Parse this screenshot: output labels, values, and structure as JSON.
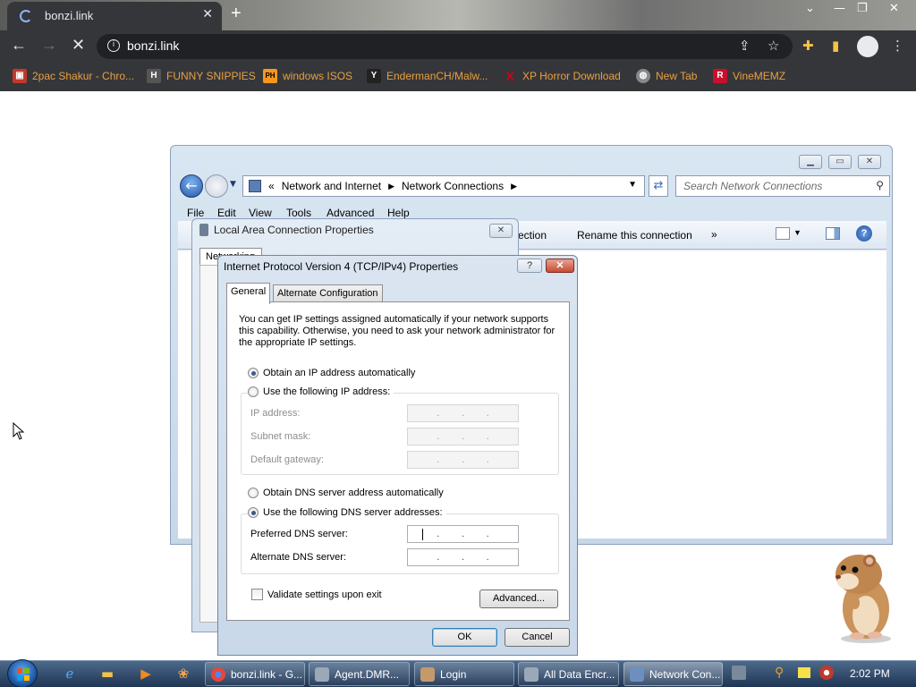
{
  "browser": {
    "tab_title": "bonzi.link",
    "url": "bonzi.link",
    "bookmarks": [
      {
        "label": "2pac Shakur - Chro...",
        "icon": "tupac-icon",
        "color": "#c0392b"
      },
      {
        "label": "FUNNY SNIPPIES",
        "icon": "h-icon",
        "color": "#555555"
      },
      {
        "label": "windows ISOS",
        "icon": "ph-icon",
        "color": "#f7971d"
      },
      {
        "label": "EndermanCH/Malw...",
        "icon": "github-icon",
        "color": "#222222"
      },
      {
        "label": "XP Horror Download",
        "icon": "x-icon",
        "color": "#d0021b"
      },
      {
        "label": "New Tab",
        "icon": "globe-icon",
        "color": "#888888"
      },
      {
        "label": "VineMEMZ",
        "icon": "r-icon",
        "color": "#c8102e"
      }
    ],
    "bookmark_glyphs": [
      "▣",
      "H",
      "PH",
      "Y",
      "X",
      "◍",
      "R"
    ]
  },
  "explorer": {
    "breadcrumb_prefix": "«",
    "breadcrumb": [
      "Network and Internet",
      "Network Connections"
    ],
    "search_placeholder": "Search Network Connections",
    "menus": [
      "File",
      "Edit",
      "View",
      "Tools",
      "Advanced",
      "Help"
    ],
    "commands": [
      "ection",
      "Rename this connection",
      "»"
    ]
  },
  "lan_properties": {
    "title": "Local Area Connection Properties",
    "tab_fragment": "Networking"
  },
  "ipv4": {
    "title": "Internet Protocol Version 4 (TCP/IPv4) Properties",
    "help_label": "?",
    "tabs": [
      "General",
      "Alternate Configuration"
    ],
    "intro": "You can get IP settings assigned automatically if your network supports this capability. Otherwise, you need to ask your network administrator for the appropriate IP settings.",
    "obtain_ip_auto": "Obtain an IP address automatically",
    "use_following_ip": "Use the following IP address:",
    "ip_address_label": "IP address:",
    "subnet_mask_label": "Subnet mask:",
    "default_gateway_label": "Default gateway:",
    "obtain_dns_auto": "Obtain DNS server address automatically",
    "use_following_dns": "Use the following DNS server addresses:",
    "preferred_dns_label": "Preferred DNS server:",
    "alternate_dns_label": "Alternate DNS server:",
    "validate_label": "Validate settings upon exit",
    "advanced_label": "Advanced...",
    "ok_label": "OK",
    "cancel_label": "Cancel",
    "ip_mode": "automatic",
    "dns_mode": "manual"
  },
  "taskbar": {
    "items": [
      {
        "label": "bonzi.link - G...",
        "icon": "chrome-icon",
        "color": "#e8453c"
      },
      {
        "label": "Agent.DMR...",
        "icon": "window-icon",
        "color": "#9aa8b8"
      },
      {
        "label": "Login",
        "icon": "user-icon",
        "color": "#c49a6c"
      },
      {
        "label": "All Data Encr...",
        "icon": "window-icon",
        "color": "#9aa8b8"
      },
      {
        "label": "Network Con...",
        "icon": "network-icon",
        "color": "#6c8fc0"
      }
    ],
    "clock": "2:02 PM"
  }
}
